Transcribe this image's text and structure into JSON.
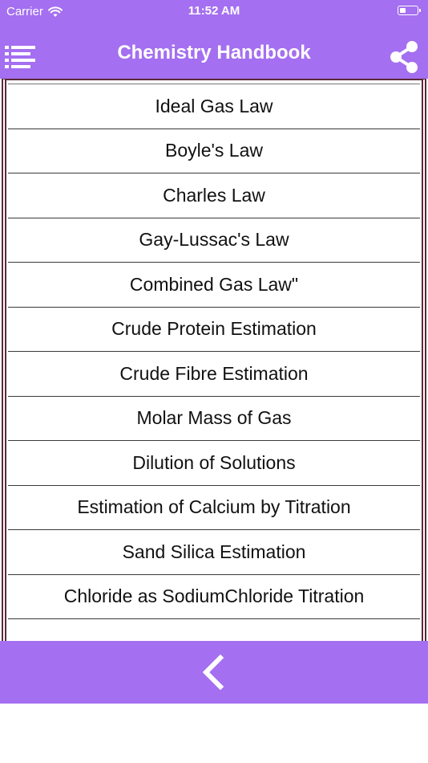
{
  "status_bar": {
    "carrier": "Carrier",
    "time": "11:52 AM",
    "icons": [
      "wifi-icon",
      "battery-icon"
    ]
  },
  "nav_bar": {
    "title": "Chemistry Handbook",
    "left_icon": "menu-icon",
    "right_icon": "share-icon"
  },
  "list": {
    "items": [
      "Ideal Gas Law",
      "Boyle's Law",
      "Charles Law",
      "Gay-Lussac's Law",
      "Combined Gas Law\"",
      "Crude Protein Estimation",
      "Crude Fibre Estimation",
      "Molar Mass of Gas",
      "Dilution of Solutions",
      "Estimation of Calcium by Titration",
      "Sand Silica Estimation",
      "Chloride as SodiumChloride Titration",
      ""
    ]
  },
  "bottom_bar": {
    "icon": "chevron-left-icon"
  },
  "colors": {
    "accent": "#a46ff0",
    "frame": "#5a2a38"
  }
}
